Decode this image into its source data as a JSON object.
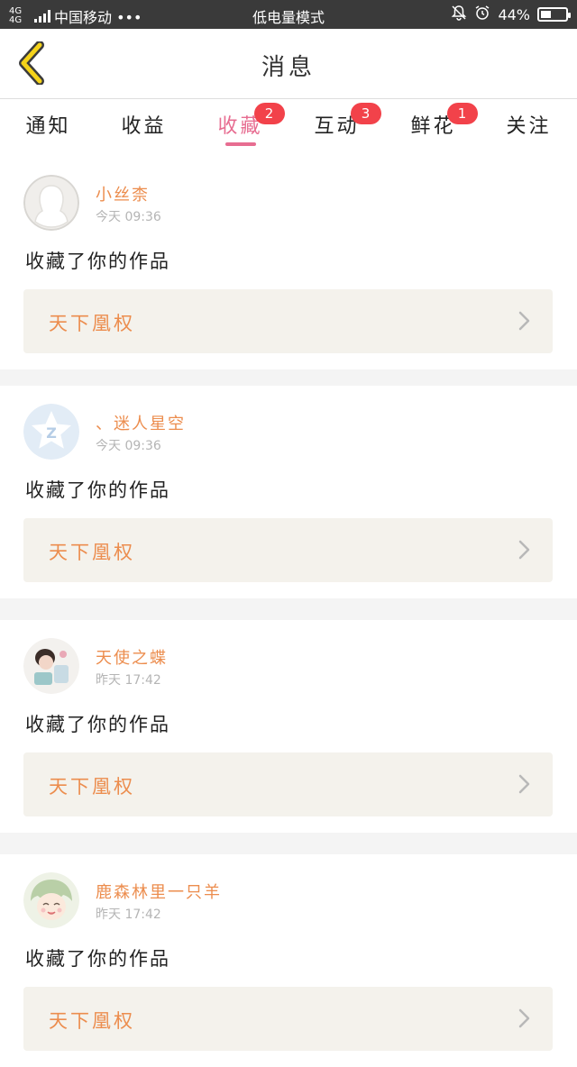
{
  "status_bar": {
    "network": "4G 4G",
    "carrier": "中国移动 •••",
    "mode": "低电量模式",
    "battery_percent": "44%",
    "battery_level": 0.44,
    "icons": [
      "signal-icon",
      "mute-bell-icon",
      "alarm-icon",
      "battery-icon"
    ]
  },
  "header": {
    "title": "消息",
    "back_icon": "chevron-left-icon",
    "back_color": "#f5d31a"
  },
  "tabs": [
    {
      "label": "通知",
      "badge": ""
    },
    {
      "label": "收益",
      "badge": ""
    },
    {
      "label": "收藏",
      "badge": "2",
      "active": true
    },
    {
      "label": "互动",
      "badge": "3"
    },
    {
      "label": "鲜花",
      "badge": "1"
    },
    {
      "label": "关注",
      "badge": ""
    }
  ],
  "messages": [
    {
      "user": "小丝柰",
      "time": "今天 09:36",
      "action": "收藏了你的作品",
      "work": "天下凰权",
      "avatar": "default-avatar-icon"
    },
    {
      "user": "、迷人星空",
      "time": "今天 09:36",
      "action": "收藏了你的作品",
      "work": "天下凰权",
      "avatar": "qq-star-avatar-icon"
    },
    {
      "user": "天使之蝶",
      "time": "昨天 17:42",
      "action": "收藏了你的作品",
      "work": "天下凰权",
      "avatar": "photo-avatar"
    },
    {
      "user": "鹿森林里一只羊",
      "time": "昨天 17:42",
      "action": "收藏了你的作品",
      "work": "天下凰权",
      "avatar": "anime-avatar"
    }
  ],
  "colors": {
    "accent_pink": "#e76d91",
    "username_orange": "#ec8d4e",
    "badge_red": "#f2424a",
    "work_bg": "#f4f2ec"
  }
}
